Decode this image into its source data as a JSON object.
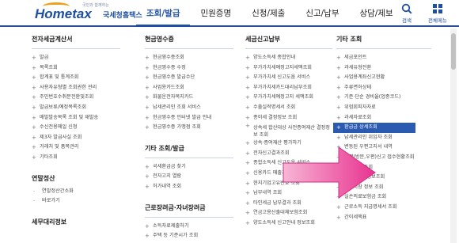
{
  "logo": {
    "slogan": "국민과 함께하는",
    "main": "Hometax",
    "sub": "국세청홈택스"
  },
  "gnb": [
    {
      "label": "조회/발급",
      "active": true
    },
    {
      "label": "민원증명",
      "active": false
    },
    {
      "label": "신청/제출",
      "active": false
    },
    {
      "label": "신고/납부",
      "active": false
    },
    {
      "label": "상담/제보",
      "active": false
    }
  ],
  "util": {
    "search_label": "검색",
    "menu_label": "전체메뉴"
  },
  "col1": {
    "title": "전자세금계산서",
    "items": [
      "발급",
      "목록조회",
      "합계표 및 통계조회",
      "사용자유형별 조회권한 관리",
      "주민번호수취분전환및조회",
      "발급보류/예정목록조회",
      "매발발송목록 조회 및 재발송",
      "수신전용메일 신청",
      "제3자 발급사실 조회",
      "거래처 및 품목관리",
      "기타조회"
    ],
    "title2": "연말정산",
    "items2": [
      "연말정산간소화",
      "바로가기"
    ],
    "title3": "세무대리정보"
  },
  "col2": {
    "title": "현금영수증",
    "items": [
      "현금영수증조회",
      "현금영수증 수정",
      "현금영수증 발급수단",
      "사업용카드조회",
      "화물운전자복지카드",
      "납세관리인 조회 서비스",
      "현금영수증 인터넷 발급 안내",
      "현금영수증 가맹점 조회"
    ],
    "title2": "기타 조회/발급",
    "items2": [
      "국세환급금 찾기",
      "전자고지 열람",
      "허가내역 조회"
    ],
    "title3": "근로장려금·자녀장려금",
    "items3": [
      "소득자료제출하기",
      "주택 등 기준시가 조회"
    ]
  },
  "col3": {
    "title": "세금신고납부",
    "items": [
      "양도소득세 종합안내",
      "부가가치세예정고지세액조회",
      "부가가치세 신고도움 서비스",
      "부가가치세카드대리납부조회",
      "부가가치세예정고지 세액조회",
      "수출실적명세서 조회",
      "종이세 결정정보 조회",
      "상속세 합산대상 사전증여재산 결정정보 조회",
      "상속·증여재산 평가하기",
      "전자신고결과조회",
      "종합소득세 신고도움 서비스",
      "신용카드 매출자료조회",
      "현지기업고유번호 조회",
      "납부내역 조회",
      "타인세금 납부결과 조회",
      "연금고용산출대체보험조회",
      "양도소득세 신고안내 정보조회"
    ]
  },
  "col4": {
    "title": "기타 조회",
    "items": [
      "세금포인트",
      "과세유형전환",
      "사업용계좌신고현황",
      "주류면허상태",
      "기준·단순 경비율(업종코드)",
      "위험회피자자료",
      "과세자료조회",
      "환급금 상세조회",
      "납세관리인 위임자 조회",
      "변동된 우편고지서 내역",
      "서면(방문,우편)신고 접수현황조회",
      "기준시가 조회",
      "상속인국세정보조회",
      "전통시장 정보 조회",
      "실손의료보험금 조회",
      "근로소득 지급명세서 조회",
      "간이세액표"
    ],
    "highlight_index": 7
  }
}
